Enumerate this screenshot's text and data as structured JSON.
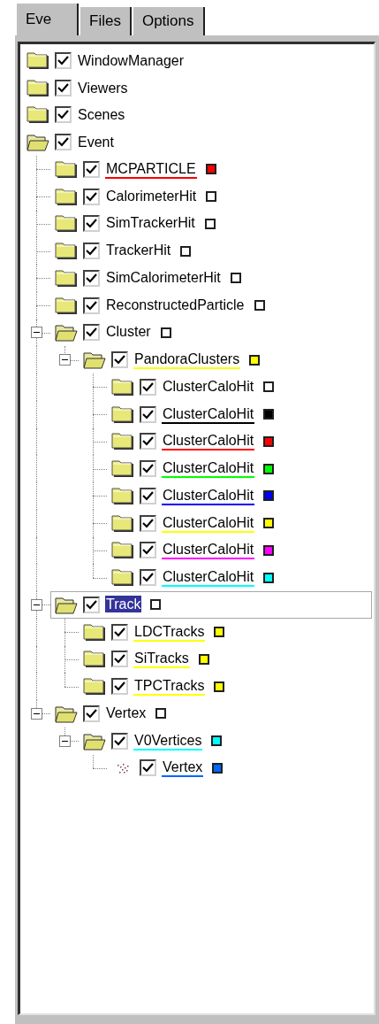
{
  "tabs": [
    {
      "label": "Eve",
      "selected": true
    },
    {
      "label": "Files",
      "selected": false
    },
    {
      "label": "Options",
      "selected": false
    }
  ],
  "tree": [
    {
      "label": "WindowManager",
      "kind": "folder",
      "checked": true,
      "selected": false
    },
    {
      "label": "Viewers",
      "kind": "folder",
      "checked": true,
      "selected": false
    },
    {
      "label": "Scenes",
      "kind": "folder",
      "checked": true,
      "selected": false
    },
    {
      "label": "Event",
      "kind": "folder",
      "checked": true,
      "selected": false,
      "expanded": true,
      "children": [
        {
          "label": "MCPARTICLE",
          "kind": "folder",
          "checked": true,
          "selected": false,
          "color": "#ff0000"
        },
        {
          "label": "CalorimeterHit",
          "kind": "folder",
          "checked": true,
          "selected": false,
          "color": "#ffffff"
        },
        {
          "label": "SimTrackerHit",
          "kind": "folder",
          "checked": true,
          "selected": false,
          "color": "#ffffff"
        },
        {
          "label": "TrackerHit",
          "kind": "folder",
          "checked": true,
          "selected": false,
          "color": "#ffffff"
        },
        {
          "label": "SimCalorimeterHit",
          "kind": "folder",
          "checked": true,
          "selected": false,
          "color": "#ffffff"
        },
        {
          "label": "ReconstructedParticle",
          "kind": "folder",
          "checked": true,
          "selected": false,
          "color": "#ffffff"
        },
        {
          "label": "Cluster",
          "kind": "folder",
          "checked": true,
          "selected": false,
          "color": "#ffffff",
          "expanded": true,
          "children": [
            {
              "label": "PandoraClusters",
              "kind": "folder",
              "checked": true,
              "selected": false,
              "color": "#ffff00",
              "expanded": true,
              "children": [
                {
                  "label": "ClusterCaloHit",
                  "kind": "folder",
                  "checked": true,
                  "selected": false,
                  "color": "#ffffff"
                },
                {
                  "label": "ClusterCaloHit",
                  "kind": "folder",
                  "checked": true,
                  "selected": false,
                  "color": "#000000"
                },
                {
                  "label": "ClusterCaloHit",
                  "kind": "folder",
                  "checked": true,
                  "selected": false,
                  "color": "#ff0000"
                },
                {
                  "label": "ClusterCaloHit",
                  "kind": "folder",
                  "checked": true,
                  "selected": false,
                  "color": "#00ff00"
                },
                {
                  "label": "ClusterCaloHit",
                  "kind": "folder",
                  "checked": true,
                  "selected": false,
                  "color": "#0000ff"
                },
                {
                  "label": "ClusterCaloHit",
                  "kind": "folder",
                  "checked": true,
                  "selected": false,
                  "color": "#ffff00"
                },
                {
                  "label": "ClusterCaloHit",
                  "kind": "folder",
                  "checked": true,
                  "selected": false,
                  "color": "#ff00ff"
                },
                {
                  "label": "ClusterCaloHit",
                  "kind": "folder",
                  "checked": true,
                  "selected": false,
                  "color": "#00ffff"
                }
              ]
            }
          ]
        },
        {
          "label": "Track",
          "kind": "folder",
          "checked": true,
          "selected": true,
          "color": "#ffffff",
          "expanded": true,
          "children": [
            {
              "label": "LDCTracks",
              "kind": "folder",
              "checked": true,
              "selected": false,
              "color": "#ffff00"
            },
            {
              "label": "SiTracks",
              "kind": "folder",
              "checked": true,
              "selected": false,
              "color": "#ffff00"
            },
            {
              "label": "TPCTracks",
              "kind": "folder",
              "checked": true,
              "selected": false,
              "color": "#ffff00"
            }
          ]
        },
        {
          "label": "Vertex",
          "kind": "folder",
          "checked": true,
          "selected": false,
          "color": "#ffffff",
          "expanded": true,
          "children": [
            {
              "label": "V0Vertices",
              "kind": "folder",
              "checked": true,
              "selected": false,
              "color": "#00ffff",
              "expanded": true,
              "children": [
                {
                  "label": "Vertex",
                  "kind": "point",
                  "checked": true,
                  "selected": false,
                  "color": "#0066ff"
                }
              ]
            }
          ]
        }
      ]
    }
  ]
}
